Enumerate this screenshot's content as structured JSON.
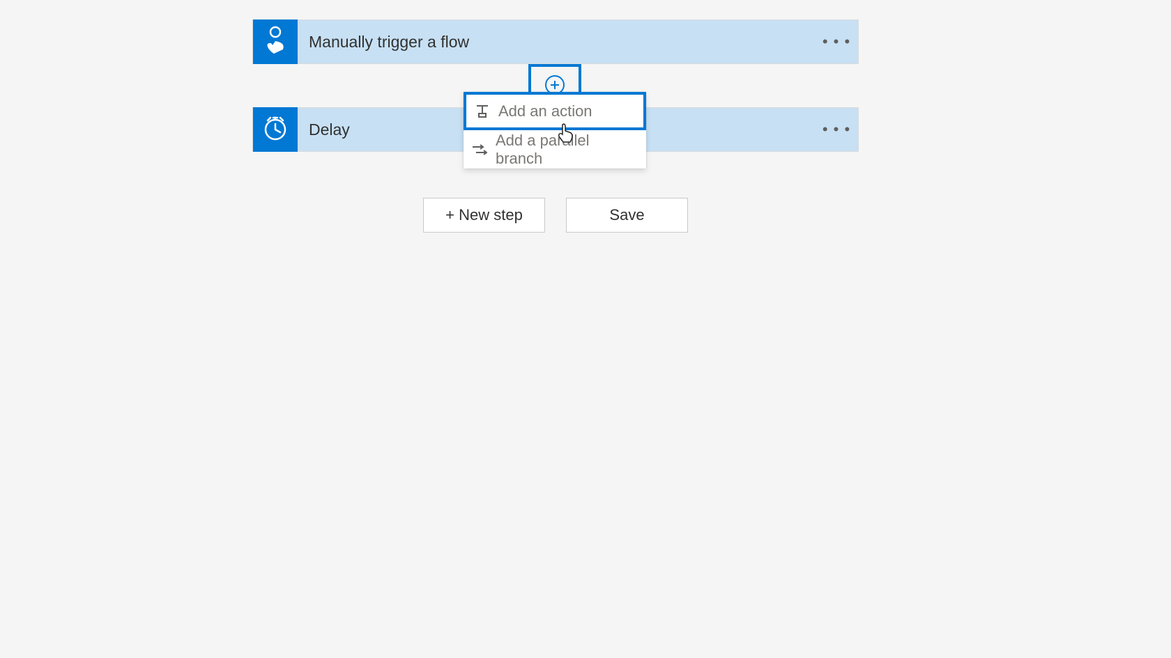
{
  "trigger": {
    "title": "Manually trigger a flow"
  },
  "delay": {
    "title": "Delay"
  },
  "popup": {
    "add_action": "Add an action",
    "add_parallel_branch": "Add a parallel branch"
  },
  "buttons": {
    "new_step": "+ New step",
    "save": "Save"
  }
}
